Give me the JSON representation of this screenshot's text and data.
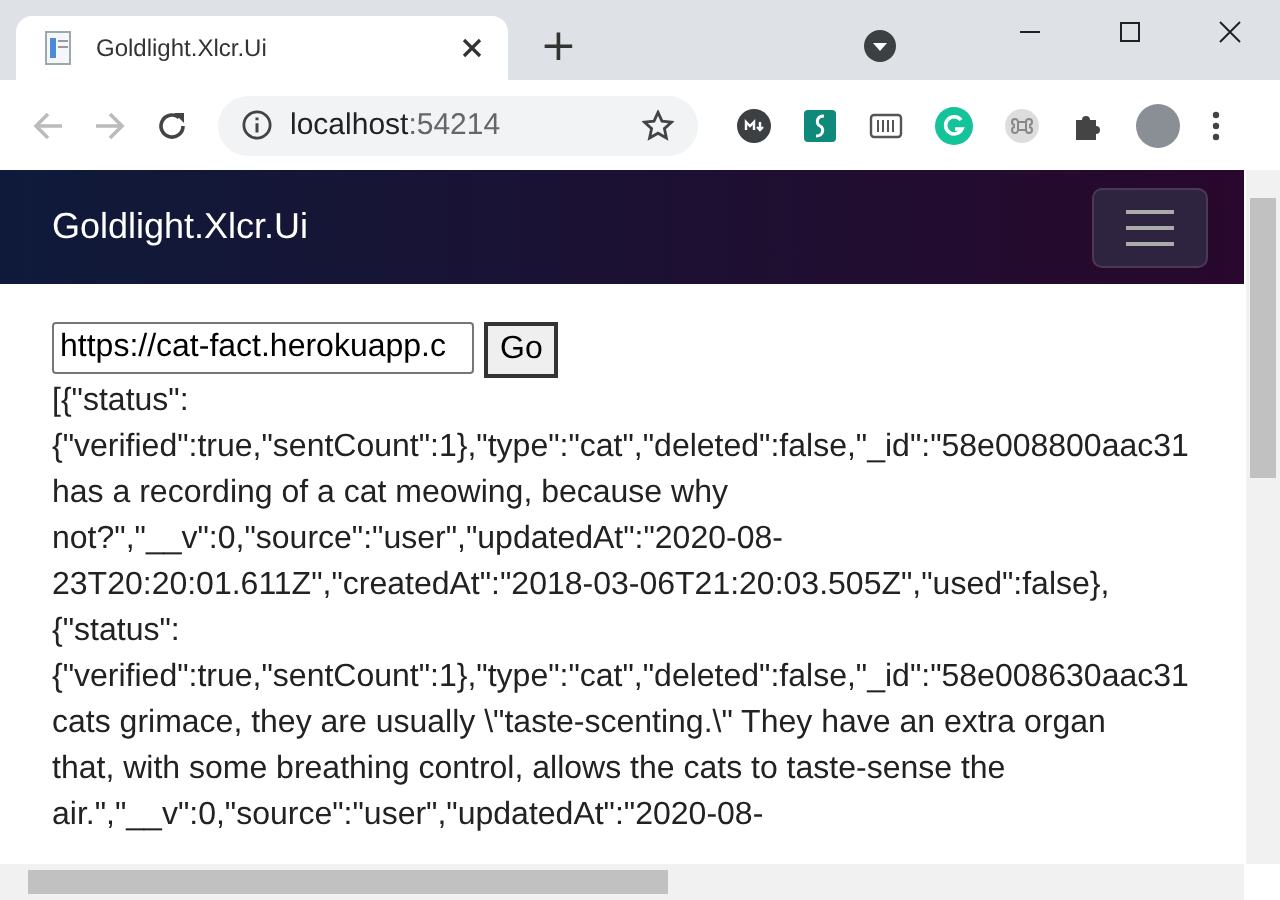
{
  "browser": {
    "tab": {
      "title": "Goldlight.Xlcr.Ui",
      "selected": true
    },
    "new_tab": "+",
    "address": {
      "host": "localhost",
      "port": ":54214"
    }
  },
  "navbar": {
    "brand": "Goldlight.Xlcr.Ui"
  },
  "url_field": {
    "value": "https://cat-fact.herokuapp.c"
  },
  "go_button": "Go",
  "output_lines": [
    "[{\"status\":",
    "{\"verified\":true,\"sentCount\":1},\"type\":\"cat\",\"deleted\":false,\"_id\":\"58e008800aac31",
    "has a recording of a cat meowing, because why",
    "not?\",\"__v\":0,\"source\":\"user\",\"updatedAt\":\"2020-08-",
    "23T20:20:01.611Z\",\"createdAt\":\"2018-03-06T21:20:03.505Z\",\"used\":false},",
    "{\"status\":",
    "{\"verified\":true,\"sentCount\":1},\"type\":\"cat\",\"deleted\":false,\"_id\":\"58e008630aac31",
    "cats grimace, they are usually \\\"taste-scenting.\\\" They have an extra organ",
    "that, with some breathing control, allows the cats to taste-sense the",
    "air.\",\"__v\":0,\"source\":\"user\",\"updatedAt\":\"2020-08-"
  ]
}
